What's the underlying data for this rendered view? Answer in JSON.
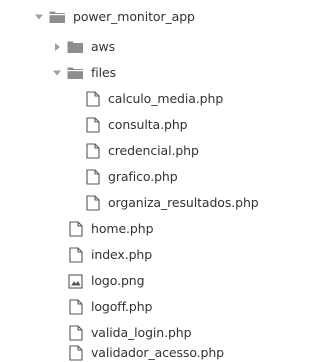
{
  "tree": {
    "root": {
      "label": "power_monitor_app",
      "expanded": true,
      "icon": "folder-open-icon"
    },
    "aws": {
      "label": "aws",
      "expanded": false,
      "icon": "folder-closed-icon"
    },
    "files": {
      "label": "files",
      "expanded": true,
      "icon": "folder-open-icon",
      "children": [
        {
          "label": "calculo_media.php",
          "icon": "file-icon"
        },
        {
          "label": "consulta.php",
          "icon": "file-icon"
        },
        {
          "label": "credencial.php",
          "icon": "file-icon"
        },
        {
          "label": "grafico.php",
          "icon": "file-icon"
        },
        {
          "label": "organiza_resultados.php",
          "icon": "file-icon"
        }
      ]
    },
    "root_files": [
      {
        "label": "home.php",
        "icon": "file-icon"
      },
      {
        "label": "index.php",
        "icon": "file-icon"
      },
      {
        "label": "logo.png",
        "icon": "image-file-icon"
      },
      {
        "label": "logoff.php",
        "icon": "file-icon"
      },
      {
        "label": "valida_login.php",
        "icon": "file-icon"
      },
      {
        "label": "validador_acesso.php",
        "icon": "file-icon"
      }
    ]
  },
  "colors": {
    "folder": "#8e8e8e",
    "arrow": "#a0a0a0",
    "file_outline": "#555555",
    "text": "#333333"
  }
}
